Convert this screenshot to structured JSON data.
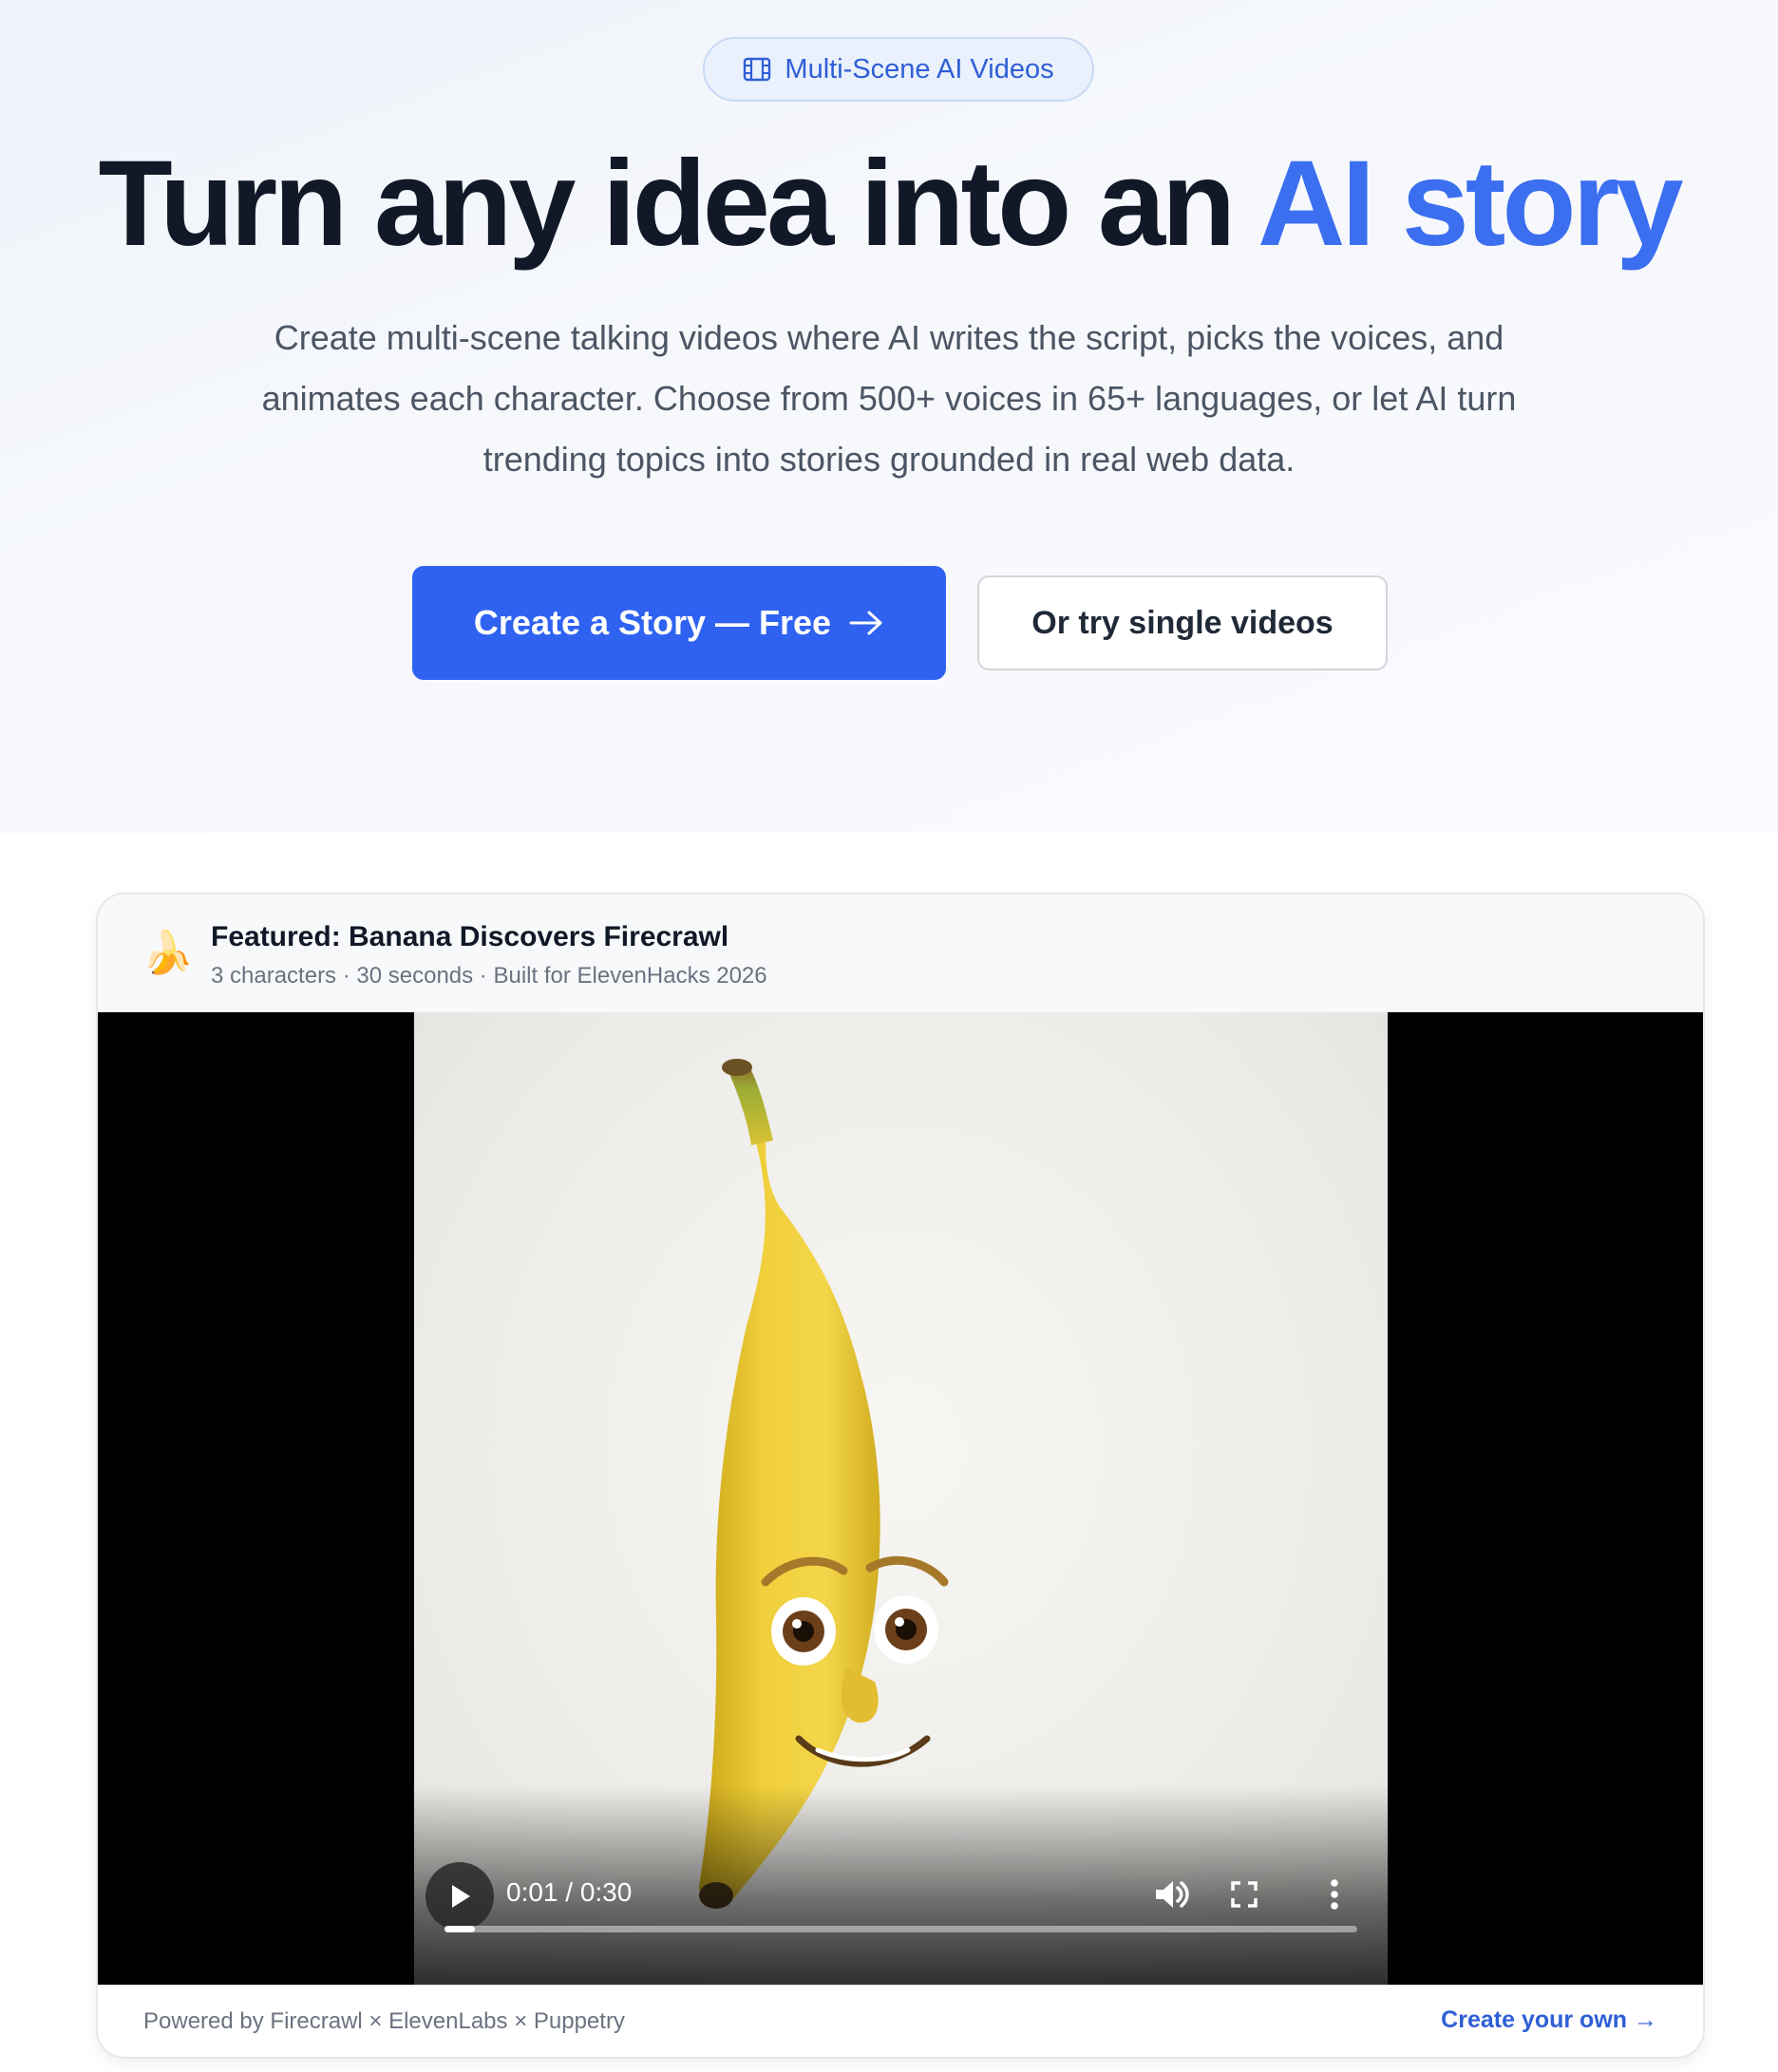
{
  "badge": {
    "icon": "film-icon",
    "label": "Multi-Scene AI Videos"
  },
  "hero": {
    "headline_main": "Turn any idea into an ",
    "headline_accent": "AI story",
    "subtitle": "Create multi-scene talking videos where AI writes the script, picks the voices, and animates each character. Choose from 500+ voices in 65+ languages, or let AI turn trending topics into stories grounded in real web data."
  },
  "buttons": {
    "primary_label": "Create a Story — Free",
    "primary_icon": "arrow-right-icon",
    "secondary_label": "Or try single videos"
  },
  "featured": {
    "emoji": "🍌",
    "title": "Featured: Banana Discovers Firecrawl",
    "meta": "3 characters · 30 seconds · Built for ElevenHacks 2026"
  },
  "video": {
    "time_display": "0:01 / 0:30",
    "progress": 0.033,
    "controls": [
      "play-icon",
      "volume-icon",
      "fullscreen-icon",
      "more-vertical-icon"
    ]
  },
  "footer": {
    "powered_by": "Powered by Firecrawl × ElevenLabs × Puppetry",
    "cta": "Create your own →"
  },
  "colors": {
    "accent": "#3b6ff0",
    "primary_button": "#2f62f0",
    "headline": "#111827"
  }
}
